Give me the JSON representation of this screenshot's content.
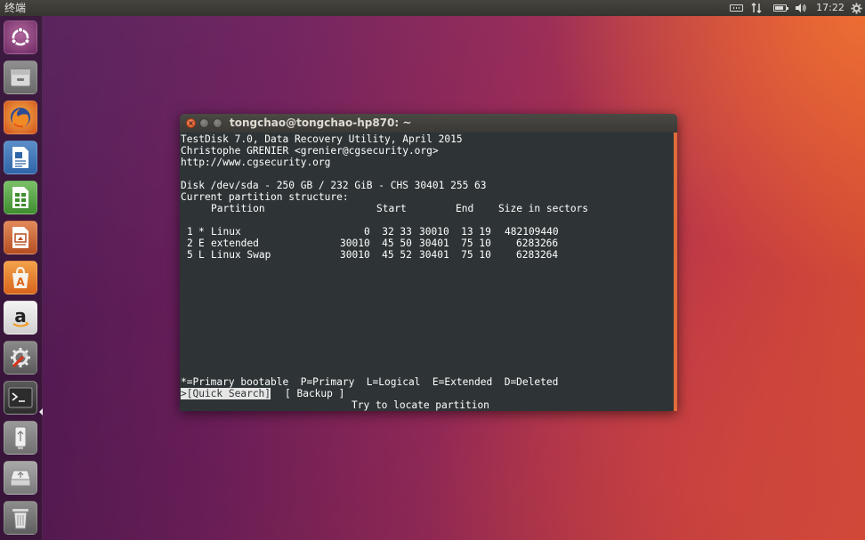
{
  "top_panel": {
    "app_title": "终端",
    "clock": "17:22",
    "tray_icons": [
      "keyboard-icon",
      "network-icon",
      "battery-icon",
      "volume-icon",
      "gear-icon"
    ]
  },
  "launcher": {
    "items": [
      "ubuntu-home-icon",
      "files-icon",
      "firefox-icon",
      "writer-icon",
      "calc-icon",
      "impress-icon",
      "software-center-icon",
      "amazon-icon",
      "system-settings-icon",
      "terminal-icon",
      "usb-drive-icon",
      "removable-drive-icon",
      "trash-icon"
    ],
    "active_item": "terminal-icon"
  },
  "window": {
    "title": "tongchao@tongchao-hp870: ~"
  },
  "terminal": {
    "header": {
      "line1": "TestDisk 7.0, Data Recovery Utility, April 2015",
      "line2": "Christophe GRENIER <grenier@cgsecurity.org>",
      "line3": "http://www.cgsecurity.org"
    },
    "disk_info": "Disk /dev/sda - 250 GB / 232 GiB - CHS 30401 255 63",
    "structure_label": "Current partition structure:",
    "columns": {
      "partition": "Partition",
      "start": "Start",
      "end": "End",
      "size": "Size in sectors"
    },
    "partitions": [
      {
        "num": "1",
        "flag": "*",
        "name": "Linux",
        "start": "0  32 33",
        "end": "30010  13 19",
        "size": "482109440"
      },
      {
        "num": "2",
        "flag": "E",
        "name": "extended",
        "start": "30010  45 50",
        "end": "30401  75 10",
        "size": "6283266"
      },
      {
        "num": "5",
        "flag": "L",
        "name": "Linux Swap",
        "start": "30010  45 52",
        "end": "30401  75 10",
        "size": "6283264"
      }
    ],
    "legend": "*=Primary bootable  P=Primary  L=Logical  E=Extended  D=Deleted",
    "quick_search_label": ">[Quick Search]",
    "backup_label": "[ Backup ]",
    "hint": "Try to locate partition",
    "colors": {
      "background": "#2e3436",
      "foreground": "#ffffff",
      "selected_bg": "#e6e6e6"
    }
  }
}
